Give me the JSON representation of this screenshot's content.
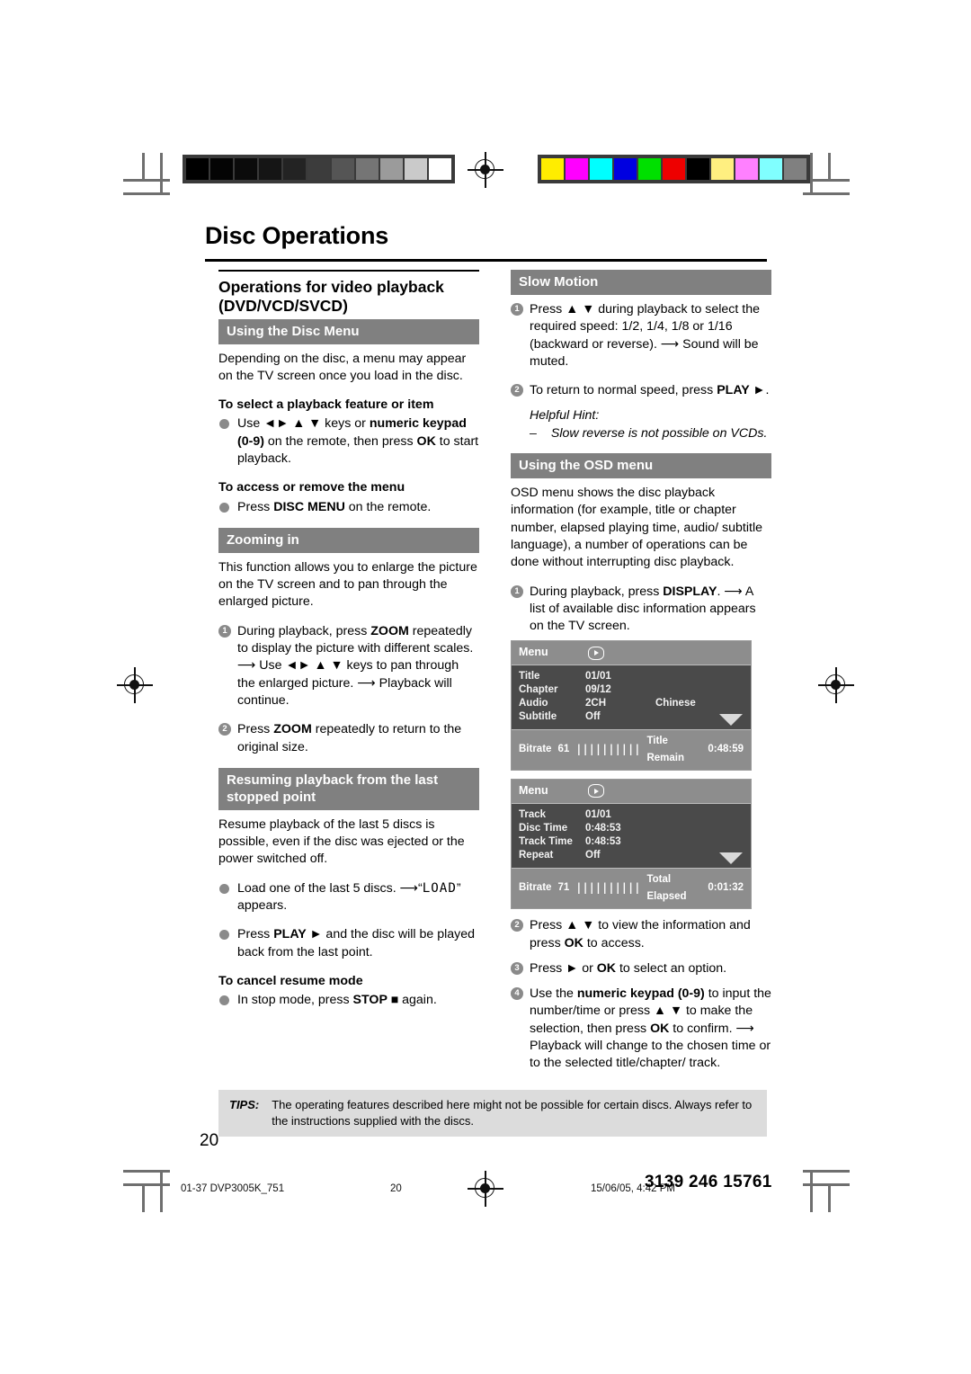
{
  "document": {
    "title": "Disc Operations",
    "page_number": "20"
  },
  "calibration": {
    "grayscale": [
      "#000000",
      "#040404",
      "#0b0b0b",
      "#151515",
      "#232323",
      "#3c3c3c",
      "#555555",
      "#757575",
      "#9b9b9b",
      "#cacaca",
      "#ffffff"
    ],
    "colors": [
      "#ffed00",
      "#ff00ff",
      "#00ffff",
      "#0000e0",
      "#00e000",
      "#ee0000",
      "#000000",
      "#ffef80",
      "#ff80ff",
      "#80ffff",
      "#808080"
    ]
  },
  "left_column": {
    "section_title": "Operations for video playback (DVD/VCD/SVCD)",
    "disc_menu": {
      "bar": "Using the Disc Menu",
      "intro": "Depending on the disc, a menu may appear on the TV screen once you load in the disc.",
      "sub1": "To select a playback feature or item",
      "item1_a": "Use ",
      "item1_keys": "◄► ▲ ▼",
      "item1_b": " keys or ",
      "item1_bold1": "numeric keypad (0-9)",
      "item1_c": " on the remote, then press ",
      "item1_bold2": "OK",
      "item1_d": " to start playback.",
      "sub2": "To access or remove the menu",
      "item2_a": "Press ",
      "item2_bold": "DISC MENU",
      "item2_b": " on the remote."
    },
    "zooming": {
      "bar": "Zooming in",
      "intro": "This function allows you to enlarge the picture on the TV screen and to pan through the enlarged picture.",
      "step1_num": "1",
      "step1_a": "During playback, press ",
      "step1_bold": "ZOOM",
      "step1_b": " repeatedly to display the picture with different scales.",
      "step1_res1_a": "Use ",
      "step1_res1_keys": "◄► ▲ ▼",
      "step1_res1_b": " keys to pan through the enlarged picture.",
      "step1_res2": "Playback will continue.",
      "step2_num": "2",
      "step2_a": "Press ",
      "step2_bold": "ZOOM",
      "step2_b": " repeatedly to return to the original size."
    },
    "resuming": {
      "bar": "Resuming playback from the last stopped point",
      "intro": "Resume playback of the last 5 discs is possible, even if the disc was ejected or the power switched off.",
      "item1": "Load one of the last 5 discs.",
      "item1_res_pre": "“",
      "item1_res_lcd": "LOAD",
      "item1_res_post": "” appears.",
      "item2_a": "Press ",
      "item2_bold": "PLAY ►",
      "item2_b": " and the disc will be played back from the last point.",
      "sub": "To cancel resume mode",
      "item3_a": "In stop mode, press ",
      "item3_bold": "STOP ■",
      "item3_b": " again."
    }
  },
  "right_column": {
    "slow_motion": {
      "bar": "Slow Motion",
      "step1_num": "1",
      "step1_a": "Press ",
      "step1_keys": "▲ ▼",
      "step1_b": " during playback to select the required speed: 1/2, 1/4, 1/8 or 1/16 (backward or reverse).",
      "step1_res": "Sound will be muted.",
      "step2_num": "2",
      "step2_a": "To return to normal speed, press ",
      "step2_bold": "PLAY ►",
      "step2_b": ".",
      "hint_label": "Helpful Hint:",
      "hint_dash": "–",
      "hint_text": "Slow reverse is not possible on VCDs."
    },
    "osd": {
      "bar": "Using the OSD menu",
      "intro": "OSD menu shows the disc playback information (for example, title or chapter number, elapsed playing time, audio/ subtitle language), a number of operations can be done without interrupting disc playback.",
      "step1_num": "1",
      "step1_a": "During playback, press ",
      "step1_bold": "DISPLAY",
      "step1_b": ".",
      "step1_res": "A list of available disc information appears on the TV screen.",
      "step2_num": "2",
      "step2_a": "Press ",
      "step2_keys": "▲ ▼",
      "step2_b": " to view the information and press ",
      "step2_bold": "OK",
      "step2_c": " to access.",
      "step3_num": "3",
      "step3_a": "Press ",
      "step3_keys": "►",
      "step3_b": " or ",
      "step3_bold": "OK",
      "step3_c": " to select an option.",
      "step4_num": "4",
      "step4_a": "Use the ",
      "step4_bold1": "numeric keypad (0-9)",
      "step4_b": " to input the number/time or press ",
      "step4_keys": "▲ ▼",
      "step4_c": " to make the selection, then press ",
      "step4_bold2": "OK",
      "step4_d": " to confirm.",
      "step4_res": "Playback will change to the chosen time or to the selected title/chapter/ track."
    },
    "osd_screens": [
      {
        "menu_label": "Menu",
        "rows": [
          {
            "key": "Title",
            "value": "01/01",
            "extra": ""
          },
          {
            "key": "Chapter",
            "value": "09/12",
            "extra": ""
          },
          {
            "key": "Audio",
            "value": "2CH",
            "extra": "Chinese"
          },
          {
            "key": "Subtitle",
            "value": "Off",
            "extra": ""
          }
        ],
        "footer_label": "Bitrate",
        "footer_value": "61",
        "footer_bars": "||||||||||",
        "footer_right_label": "Title Remain",
        "footer_right_value": "0:48:59"
      },
      {
        "menu_label": "Menu",
        "rows": [
          {
            "key": "Track",
            "value": "01/01",
            "extra": ""
          },
          {
            "key": "Disc Time",
            "value": "0:48:53",
            "extra": ""
          },
          {
            "key": "Track Time",
            "value": "0:48:53",
            "extra": ""
          },
          {
            "key": "Repeat",
            "value": "Off",
            "extra": ""
          }
        ],
        "footer_label": "Bitrate",
        "footer_value": "71",
        "footer_bars": "||||||||||",
        "footer_right_label": "Total Elapsed",
        "footer_right_value": "0:01:32"
      }
    ]
  },
  "tips": {
    "label": "TIPS:",
    "text": "The operating features described here might not be possible for certain discs.  Always refer to the instructions supplied with the discs."
  },
  "footer": {
    "file": "01-37 DVP3005K_751",
    "page": "20",
    "timestamp": "15/06/05, 4:42 PM",
    "code": "3139 246 15761"
  }
}
